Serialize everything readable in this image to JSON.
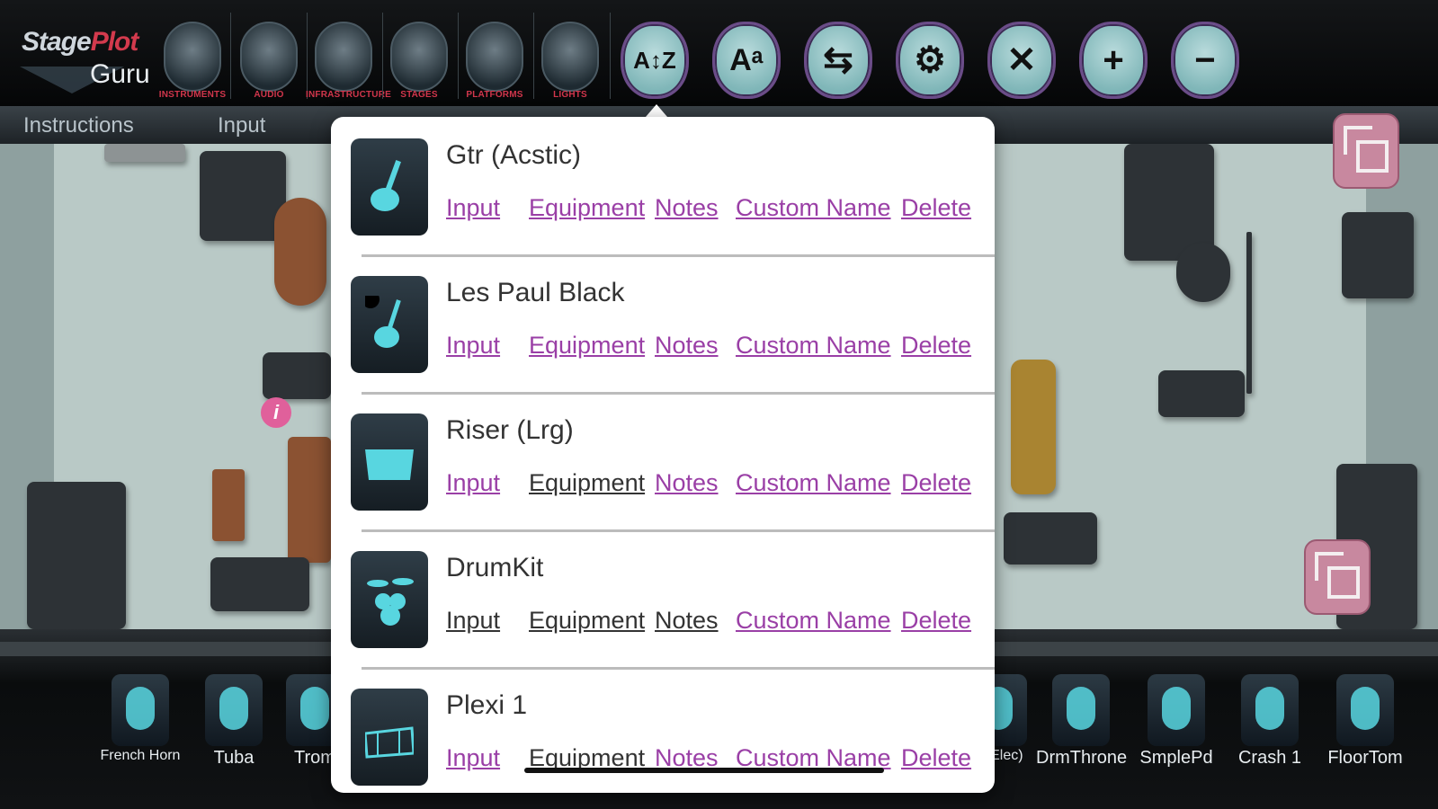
{
  "app": {
    "logo_top": "StagePlot",
    "logo_accent": "Plot",
    "logo_prefix": "Stage",
    "logo_bottom": "Guru"
  },
  "toolbar": {
    "categories": [
      {
        "label": "INSTRUMENTS",
        "icon": "guitar-icon"
      },
      {
        "label": "AUDIO",
        "icon": "amplifier-icon"
      },
      {
        "label": "INFRASTRUCTURE",
        "icon": "stool-icon"
      },
      {
        "label": "STAGES",
        "icon": "stage-icon"
      },
      {
        "label": "PLATFORMS",
        "icon": "platform-icon"
      },
      {
        "label": "LIGHTS",
        "icon": "spotlight-icon"
      }
    ],
    "actions": [
      {
        "icon": "sort-az-icon",
        "glyph": "A↕Z"
      },
      {
        "icon": "font-size-icon",
        "glyph": "Aᵃ"
      },
      {
        "icon": "arrange-icon",
        "glyph": "⇆"
      },
      {
        "icon": "settings-gear-icon",
        "glyph": "⚙"
      },
      {
        "icon": "tools-icon",
        "glyph": "✕"
      },
      {
        "icon": "zoom-in-icon",
        "glyph": "+"
      },
      {
        "icon": "zoom-out-icon",
        "glyph": "−"
      }
    ]
  },
  "tabs": [
    "Instructions",
    "Input"
  ],
  "popover": {
    "items": [
      {
        "name": "Gtr (Acstic)",
        "thumb": "acoustic-guitar-icon",
        "input_active": true,
        "equipment_active": true
      },
      {
        "name": "Les Paul Black",
        "thumb": "electric-guitar-icon",
        "input_active": true,
        "equipment_active": true
      },
      {
        "name": "Riser (Lrg)",
        "thumb": "riser-icon",
        "input_active": true,
        "equipment_active": false
      },
      {
        "name": "DrumKit",
        "thumb": "drumkit-icon",
        "input_active": false,
        "equipment_active": false
      },
      {
        "name": "Plexi 1",
        "thumb": "plexi-shield-icon",
        "input_active": true,
        "equipment_active": false
      }
    ],
    "link_labels": {
      "input": "Input",
      "equipment": "Equipment",
      "notes": "Notes",
      "custom_name": "Custom Name",
      "delete": "Delete"
    }
  },
  "tray": {
    "items": [
      "French Horn",
      "Tuba",
      "Trom",
      "n (Elec)",
      "DrmThrone",
      "SmplePd",
      "Crash 1",
      "FloorTom"
    ]
  },
  "stage": {
    "info_badge": "i"
  },
  "colors": {
    "accent": "#9a3fa6",
    "toolbar_button": "#7fb6b8",
    "stage": "#b9c9c6",
    "badge": "#e0609b"
  }
}
